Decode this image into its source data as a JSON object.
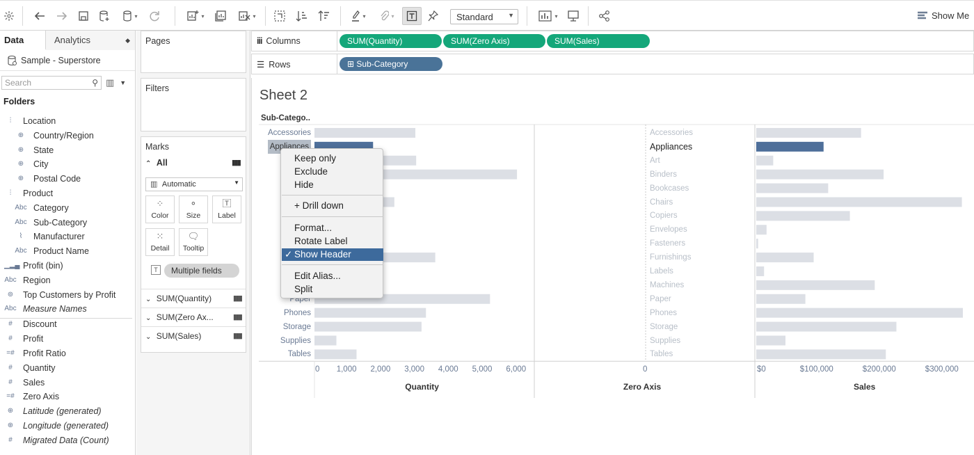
{
  "toolbar": {
    "mark_size_select": "Standard",
    "show_me": "Show Me"
  },
  "data_pane": {
    "tab_data": "Data",
    "tab_analytics": "Analytics",
    "datasource": "Sample - Superstore",
    "search_placeholder": "Search",
    "folders_heading": "Folders",
    "fields": [
      {
        "label": "Location",
        "icon": "hierarchy-icon",
        "indent": 0
      },
      {
        "label": "Country/Region",
        "icon": "globe-icon",
        "indent": 1
      },
      {
        "label": "State",
        "icon": "globe-icon",
        "indent": 1
      },
      {
        "label": "City",
        "icon": "globe-icon",
        "indent": 1
      },
      {
        "label": "Postal Code",
        "icon": "globe-icon",
        "indent": 1
      },
      {
        "label": "Product",
        "icon": "hierarchy-icon",
        "indent": 0
      },
      {
        "label": "Category",
        "icon": "abc-icon",
        "indent": 1
      },
      {
        "label": "Sub-Category",
        "icon": "abc-icon",
        "indent": 1
      },
      {
        "label": "Manufacturer",
        "icon": "paperclip-icon",
        "indent": 1
      },
      {
        "label": "Product Name",
        "icon": "abc-icon",
        "indent": 1
      },
      {
        "label": "Profit (bin)",
        "icon": "bin-histogram-icon",
        "indent": 0
      },
      {
        "label": "Region",
        "icon": "abc-icon",
        "indent": 0
      },
      {
        "label": "Top Customers by Profit",
        "icon": "set-icon",
        "indent": 0
      },
      {
        "label": "Measure Names",
        "icon": "abc-icon",
        "indent": 0,
        "italic": true
      },
      {
        "label": "Discount",
        "icon": "hash-icon",
        "indent": 0
      },
      {
        "label": "Profit",
        "icon": "hash-icon",
        "indent": 0
      },
      {
        "label": "Profit Ratio",
        "icon": "calc-hash-icon",
        "indent": 0
      },
      {
        "label": "Quantity",
        "icon": "hash-icon",
        "indent": 0
      },
      {
        "label": "Sales",
        "icon": "hash-icon",
        "indent": 0
      },
      {
        "label": "Zero Axis",
        "icon": "calc-hash-icon",
        "indent": 0
      },
      {
        "label": "Latitude (generated)",
        "icon": "globe-icon",
        "indent": 0,
        "italic": true
      },
      {
        "label": "Longitude (generated)",
        "icon": "globe-icon",
        "indent": 0,
        "italic": true
      },
      {
        "label": "Migrated Data (Count)",
        "icon": "hash-icon",
        "indent": 0,
        "italic": true
      }
    ]
  },
  "cards": {
    "pages": "Pages",
    "filters": "Filters",
    "marks": "Marks",
    "marks_all": "All",
    "mark_type": "Automatic",
    "mark_buttons": [
      "Color",
      "Size",
      "Label",
      "Detail",
      "Tooltip"
    ],
    "multiple_fields": "Multiple fields",
    "measures": [
      "SUM(Quantity)",
      "SUM(Zero Ax...",
      "SUM(Sales)"
    ]
  },
  "shelves": {
    "columns_label": "Columns",
    "rows_label": "Rows",
    "column_pills": [
      "SUM(Quantity)",
      "SUM(Zero Axis)",
      "SUM(Sales)"
    ],
    "row_pills": [
      "⊞ Sub-Category"
    ]
  },
  "view": {
    "sheet_title": "Sheet 2",
    "row_header": "Sub-Catego.."
  },
  "context_menu": {
    "items": [
      "Keep only",
      "Exclude",
      "Hide",
      "+ Drill down",
      "Format...",
      "Rotate Label",
      "Show Header",
      "Edit Alias...",
      "Split"
    ],
    "checked_item": "Show Header"
  },
  "chart_data": {
    "type": "bar",
    "orientation": "horizontal",
    "categories": [
      "Accessories",
      "Appliances",
      "Art",
      "Binders",
      "Bookcases",
      "Chairs",
      "Copiers",
      "Envelopes",
      "Fasteners",
      "Furnishings",
      "Labels",
      "Machines",
      "Paper",
      "Phones",
      "Storage",
      "Supplies",
      "Tables"
    ],
    "left_visible_labels": {
      "0": "Accessories",
      "1": "Appliances",
      "4": "Boo",
      "7": "Env",
      "8": "Fa",
      "9": "Furn",
      "11": "M",
      "12": "Paper",
      "13": "Phones",
      "14": "Storage",
      "15": "Supplies",
      "16": "Tables"
    },
    "highlighted_category": "Appliances",
    "series": [
      {
        "name": "Quantity",
        "values": [
          2976,
          1729,
          3000,
          5974,
          868,
          2356,
          234,
          906,
          914,
          3563,
          1400,
          440,
          5178,
          3289,
          3158,
          647,
          1241
        ]
      },
      {
        "name": "Zero Axis",
        "values": [
          0,
          0,
          0,
          0,
          0,
          0,
          0,
          0,
          0,
          0,
          0,
          0,
          0,
          0,
          0,
          0,
          0
        ]
      },
      {
        "name": "Sales",
        "values": [
          167380,
          107532,
          27119,
          203413,
          114880,
          328449,
          149528,
          16476,
          3024,
          91705,
          12486,
          189239,
          78479,
          330007,
          223844,
          46674,
          206966
        ]
      }
    ],
    "axes": [
      {
        "title": "Quantity",
        "ticks": [
          "0",
          "1,000",
          "2,000",
          "3,000",
          "4,000",
          "5,000",
          "6,000"
        ],
        "range": [
          0,
          6300
        ]
      },
      {
        "title": "Zero Axis",
        "ticks": [
          "0"
        ],
        "range": [
          -1,
          1
        ]
      },
      {
        "title": "Sales",
        "ticks": [
          "$0",
          "$100,000",
          "$200,000",
          "$300,000"
        ],
        "range": [
          0,
          340000
        ]
      }
    ],
    "colors": {
      "bar": "#dcdfe5",
      "highlight": "#4e6f9a"
    }
  }
}
